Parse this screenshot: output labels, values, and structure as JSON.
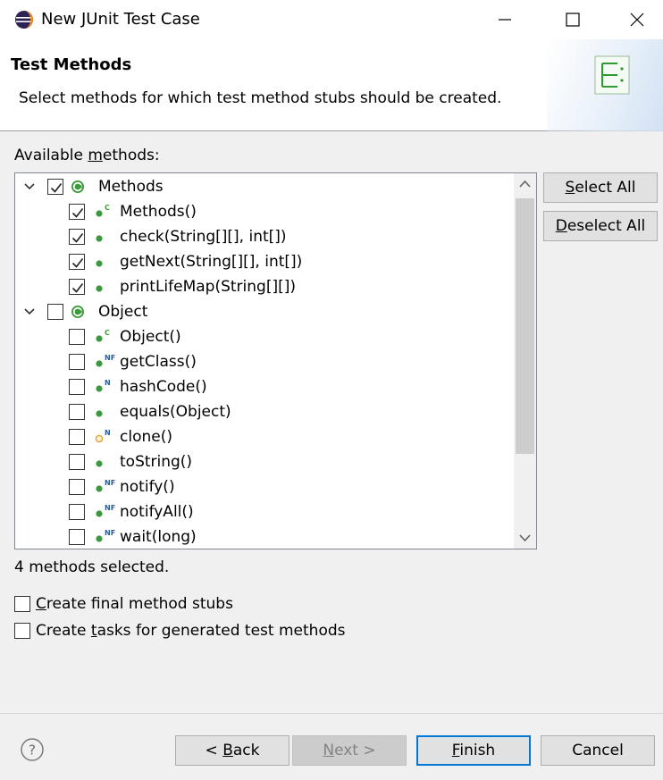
{
  "window": {
    "title": "New JUnit Test Case"
  },
  "banner": {
    "title": "Test Methods",
    "description": "Select methods for which test method stubs should be created."
  },
  "methods_section": {
    "label_prefix": "Available ",
    "label_mnemonic": "m",
    "label_suffix": "ethods:"
  },
  "tree": {
    "classes": [
      {
        "name": "Methods",
        "expanded": true,
        "checked": true,
        "methods": [
          {
            "label": "Methods()",
            "checked": true,
            "marker": "C",
            "icon": "public-constructor-icon"
          },
          {
            "label": "check(String[][], int[])",
            "checked": true,
            "marker": "",
            "icon": "public-method-icon"
          },
          {
            "label": "getNext(String[][], int[])",
            "checked": true,
            "marker": "",
            "icon": "public-method-icon"
          },
          {
            "label": "printLifeMap(String[][])",
            "checked": true,
            "marker": "",
            "icon": "public-method-icon"
          }
        ]
      },
      {
        "name": "Object",
        "expanded": true,
        "checked": false,
        "methods": [
          {
            "label": "Object()",
            "checked": false,
            "marker": "C",
            "icon": "public-constructor-icon"
          },
          {
            "label": "getClass()",
            "checked": false,
            "marker": "NF",
            "icon": "native-final-method-icon"
          },
          {
            "label": "hashCode()",
            "checked": false,
            "marker": "N",
            "icon": "native-method-icon"
          },
          {
            "label": "equals(Object)",
            "checked": false,
            "marker": "",
            "icon": "public-method-icon"
          },
          {
            "label": "clone()",
            "checked": false,
            "marker": "N",
            "icon": "protected-native-method-icon"
          },
          {
            "label": "toString()",
            "checked": false,
            "marker": "",
            "icon": "public-method-icon"
          },
          {
            "label": "notify()",
            "checked": false,
            "marker": "NF",
            "icon": "native-final-method-icon"
          },
          {
            "label": "notifyAll()",
            "checked": false,
            "marker": "NF",
            "icon": "native-final-method-icon"
          },
          {
            "label": "wait(long)",
            "checked": false,
            "marker": "NF",
            "icon": "native-final-method-icon"
          }
        ]
      }
    ]
  },
  "side_buttons": {
    "select_all_mnemonic": "S",
    "select_all_rest": "elect All",
    "deselect_all_mnemonic": "D",
    "deselect_all_rest": "eselect All"
  },
  "status": "4 methods selected.",
  "options": {
    "final_mnemonic": "C",
    "final_rest": "reate final method stubs",
    "tasks_before": "Create ",
    "tasks_mnemonic": "t",
    "tasks_after": "asks for generated test methods",
    "final_checked": false,
    "tasks_checked": false
  },
  "footer": {
    "back_prefix": "< ",
    "back_mnemonic": "B",
    "back_rest": "ack",
    "next_mnemonic": "N",
    "next_rest": "ext >",
    "finish_mnemonic": "F",
    "finish_rest": "inish",
    "cancel_label": "Cancel",
    "help_icon": "help-icon"
  },
  "colors": {
    "method_green": "#3c9a3c",
    "protected_orange": "#e9a030",
    "focus_blue": "#0078d7",
    "eclipse_purple": "#2c2255"
  }
}
